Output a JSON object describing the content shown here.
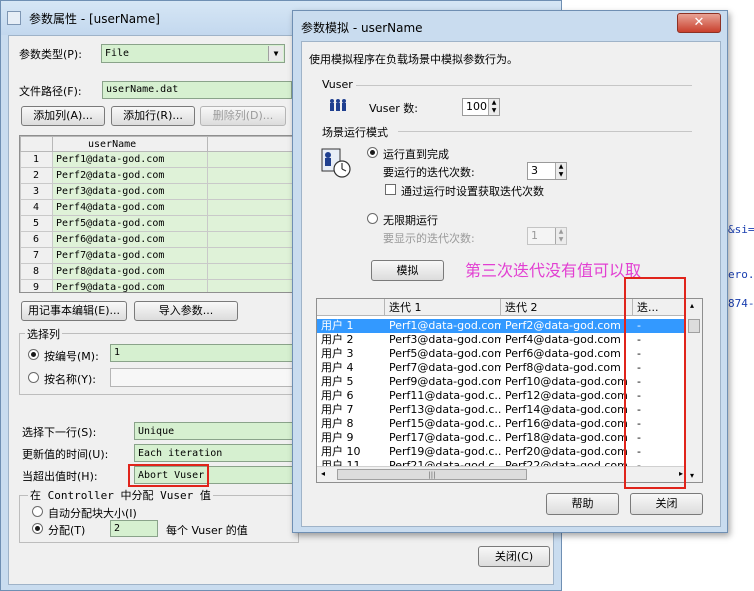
{
  "background": {
    "links": [
      "&si=",
      "ero.l",
      "874-"
    ]
  },
  "param_props": {
    "title": "参数属性 - [userName]",
    "type_label": "参数类型(P):",
    "type_value": "File",
    "path_label": "文件路径(F):",
    "path_value": "userName.dat",
    "add_col": "添加列(A)...",
    "add_row": "添加行(R)...",
    "del_col": "删除列(D)...",
    "column_header": "userName",
    "rows": [
      {
        "num": "1",
        "value": "Perf1@data-god.com"
      },
      {
        "num": "2",
        "value": "Perf2@data-god.com"
      },
      {
        "num": "3",
        "value": "Perf3@data-god.com"
      },
      {
        "num": "4",
        "value": "Perf4@data-god.com"
      },
      {
        "num": "5",
        "value": "Perf5@data-god.com"
      },
      {
        "num": "6",
        "value": "Perf6@data-god.com"
      },
      {
        "num": "7",
        "value": "Perf7@data-god.com"
      },
      {
        "num": "8",
        "value": "Perf8@data-god.com"
      },
      {
        "num": "9",
        "value": "Perf9@data-god.com"
      }
    ],
    "notepad_btn": "用记事本编辑(E)...",
    "import_btn": "导入参数...",
    "select_col_title": "选择列",
    "by_number_label": "按编号(M):",
    "by_number_value": "1",
    "by_name_label": "按名称(Y):",
    "next_row_label": "选择下一行(S):",
    "next_row_value": "Unique",
    "update_label": "更新值的时间(U):",
    "update_value": "Each iteration",
    "out_of_values_label": "当超出值时(H):",
    "out_of_values_value": "Abort Vuser",
    "controller_title": "在 Controller 中分配 Vuser 值",
    "auto_alloc_label": "自动分配块大小(I)",
    "alloc_label": "分配(T)",
    "alloc_value": "2",
    "alloc_suffix": "每个 Vuser 的值",
    "close_btn": "关闭(C)"
  },
  "simulation": {
    "title": "参数模拟 - userName",
    "close_x": "✕",
    "description": "使用模拟程序在负载场景中模拟参数行为。",
    "vuser_section": "Vuser",
    "vuser_count_label": "Vuser 数:",
    "vuser_count_value": "100",
    "run_mode_section": "场景运行模式",
    "run_until_complete": "运行直到完成",
    "iterations_label": "要运行的迭代次数:",
    "iterations_value": "3",
    "get_from_runtime": "通过运行时设置获取迭代次数",
    "run_indefinitely": "无限期运行",
    "show_iterations_label": "要显示的迭代次数:",
    "show_iterations_value": "1",
    "simulate_btn": "模拟",
    "annotation": "第三次迭代没有值可以取",
    "annotation_color": "#e23fd2",
    "highlight_color": "#e0241b",
    "columns": [
      "",
      "迭代 1",
      "迭代 2",
      "迭..."
    ],
    "rows": [
      {
        "user": "用户 1",
        "it1": "Perf1@data-god.com",
        "it2": "Perf2@data-god.com",
        "it3": "-"
      },
      {
        "user": "用户 2",
        "it1": "Perf3@data-god.com",
        "it2": "Perf4@data-god.com",
        "it3": "-"
      },
      {
        "user": "用户 3",
        "it1": "Perf5@data-god.com",
        "it2": "Perf6@data-god.com",
        "it3": "-"
      },
      {
        "user": "用户 4",
        "it1": "Perf7@data-god.com",
        "it2": "Perf8@data-god.com",
        "it3": "-"
      },
      {
        "user": "用户 5",
        "it1": "Perf9@data-god.com",
        "it2": "Perf10@data-god.com",
        "it3": "-"
      },
      {
        "user": "用户 6",
        "it1": "Perf11@data-god.c...",
        "it2": "Perf12@data-god.com",
        "it3": "-"
      },
      {
        "user": "用户 7",
        "it1": "Perf13@data-god.c...",
        "it2": "Perf14@data-god.com",
        "it3": "-"
      },
      {
        "user": "用户 8",
        "it1": "Perf15@data-god.c...",
        "it2": "Perf16@data-god.com",
        "it3": "-"
      },
      {
        "user": "用户 9",
        "it1": "Perf17@data-god.c...",
        "it2": "Perf18@data-god.com",
        "it3": "-"
      },
      {
        "user": "用户 10",
        "it1": "Perf19@data-god.c...",
        "it2": "Perf20@data-god.com",
        "it3": "-"
      },
      {
        "user": "用户 11",
        "it1": "Perf21@data-god.c...",
        "it2": "Perf22@data-god.com",
        "it3": "-"
      }
    ],
    "help_btn": "帮助",
    "close_btn": "关闭"
  }
}
